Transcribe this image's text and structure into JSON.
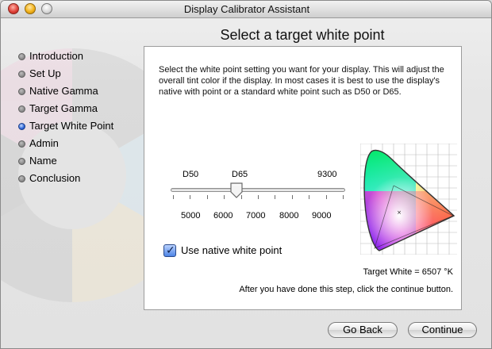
{
  "window": {
    "title": "Display Calibrator Assistant"
  },
  "page": {
    "heading": "Select a target white point"
  },
  "steps": [
    {
      "label": "Introduction",
      "active": false
    },
    {
      "label": "Set Up",
      "active": false
    },
    {
      "label": "Native Gamma",
      "active": false
    },
    {
      "label": "Target Gamma",
      "active": false
    },
    {
      "label": "Target White Point",
      "active": true
    },
    {
      "label": "Admin",
      "active": false
    },
    {
      "label": "Name",
      "active": false
    },
    {
      "label": "Conclusion",
      "active": false
    }
  ],
  "panel": {
    "description": "Select the white point setting you want for your display.  This will adjust the overall tint color if the display.  In most cases it is best to use the display's native with point or a standard white point such as D50 or D65.",
    "slider": {
      "preset_labels": [
        "D50",
        "D65",
        "9300"
      ],
      "scale_labels": [
        "5000",
        "6000",
        "7000",
        "8000",
        "9000"
      ],
      "value_kelvin": 6507,
      "min_kelvin": 4500,
      "max_kelvin": 9800
    },
    "native_checkbox": {
      "label": "Use native white point",
      "checked": true
    },
    "target_white_text": "Target White = 6507 °K",
    "hint_text": "After you have done this step, click the continue button."
  },
  "buttons": {
    "back": "Go Back",
    "continue": "Continue"
  }
}
